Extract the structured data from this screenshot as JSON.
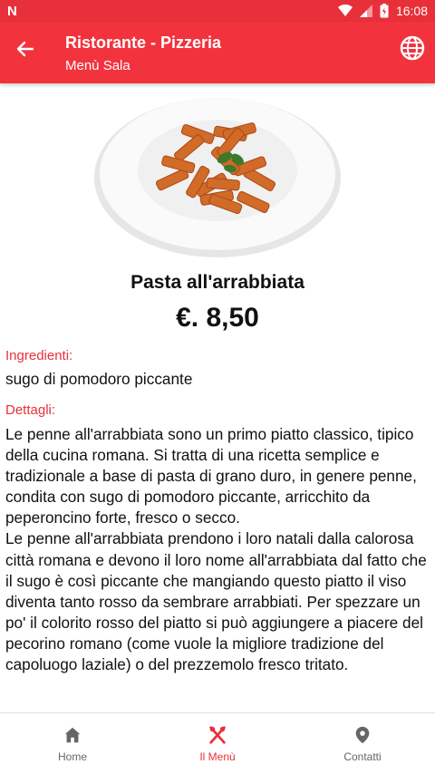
{
  "status_bar": {
    "left_icon": "notification-n-icon",
    "time": "16:08"
  },
  "app_bar": {
    "title": "Ristorante - Pizzeria",
    "subtitle": "Menù Sala"
  },
  "dish": {
    "name": "Pasta all'arrabbiata",
    "price": "€. 8,50",
    "ingredients_label": "Ingredienti:",
    "ingredients": "sugo di pomodoro piccante",
    "details_label": "Dettagli:",
    "details": [
      "Le penne all'arrabbiata sono un primo piatto classico, tipico della cucina romana. Si tratta di una ricetta semplice e tradizionale a base di pasta di grano duro, in genere penne, condita con sugo di pomodoro piccante, arricchito da peperoncino forte, fresco o secco.",
      "Le penne all'arrabbiata prendono i loro natali dalla calorosa città romana e devono il loro nome all'arrabbiata dal fatto che il sugo è così piccante che mangiando questo piatto il viso diventa tanto rosso da sembrare arrabbiati. Per spezzare un po' il colorito rosso del piatto si può aggiungere a piacere del pecorino romano (come vuole la migliore tradizione del capoluogo laziale) o del prezzemolo fresco tritato."
    ]
  },
  "bottom_nav": [
    {
      "label": "Home",
      "icon": "home-icon"
    },
    {
      "label": "Il Menù",
      "icon": "fork-knife-icon"
    },
    {
      "label": "Contatti",
      "icon": "map-pin-icon"
    }
  ],
  "colors": {
    "accent": "#f2333d",
    "status_bar": "#e8303a"
  }
}
